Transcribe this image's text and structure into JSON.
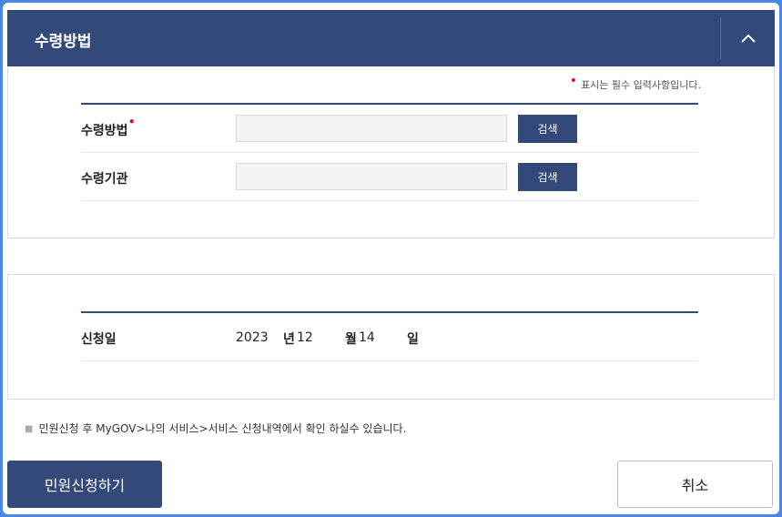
{
  "header": {
    "title": "수령방법",
    "toggle_icon": "chevron-up-icon"
  },
  "required_note": {
    "marker": "•",
    "text": "표시는 필수 입력사항입니다."
  },
  "fields": [
    {
      "label": "수령방법",
      "required": true,
      "value": "",
      "button": "검색"
    },
    {
      "label": "수령기관",
      "required": false,
      "value": "",
      "button": "검색"
    }
  ],
  "application_date": {
    "label": "신청일",
    "year": "2023",
    "year_unit": "년",
    "month": "12",
    "month_unit": "월",
    "day": "14",
    "day_unit": "일"
  },
  "notice": "민원신청 후 MyGOV>나의 서비스>서비스 신청내역에서 확인 하실수 있습니다.",
  "actions": {
    "apply": "민원신청하기",
    "cancel": "취소"
  },
  "colors": {
    "primary": "#33497a",
    "required": "#e0121b",
    "frame": "#4a86e8"
  }
}
